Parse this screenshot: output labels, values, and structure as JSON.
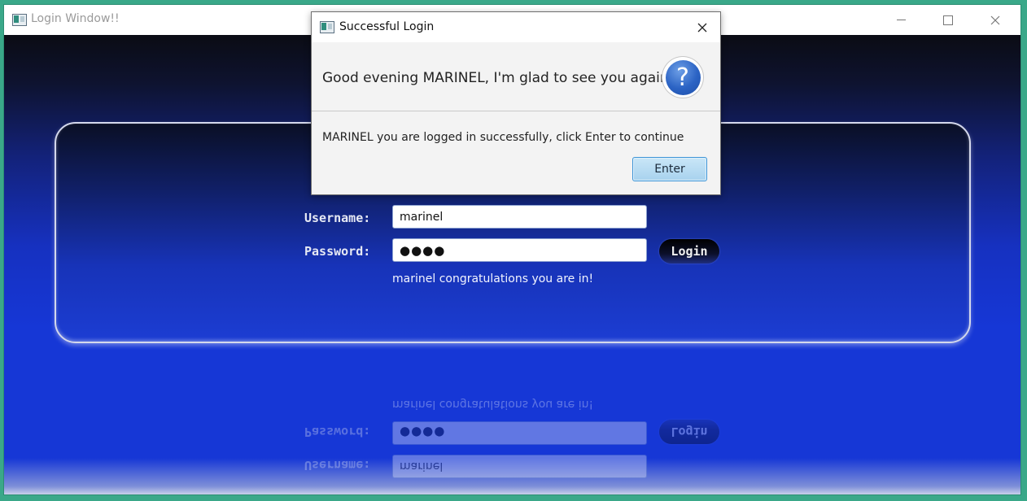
{
  "window": {
    "title": "Login Window!!",
    "icon": "java-app-icon",
    "controls": [
      "minimize-icon",
      "maximize-icon",
      "close-icon"
    ]
  },
  "form": {
    "username_label": "Username:",
    "username_value": "marinel",
    "password_label": "Password:",
    "password_value": "●●●●",
    "login_label": "Login",
    "status_message": "marinel congratulations you are in!"
  },
  "dialog": {
    "title": "Successful Login",
    "icon": "java-app-icon",
    "header_text": "Good evening MARINEL, I'm glad to see you again",
    "header_icon": "question-icon",
    "header_icon_glyph": "?",
    "content_text": "MARINEL you are logged in successfully, click Enter to continue",
    "enter_label": "Enter"
  },
  "colors": {
    "desktop": "#3aa889",
    "accent_blue": "#1637d6",
    "button_focus": "#3c94d6"
  }
}
